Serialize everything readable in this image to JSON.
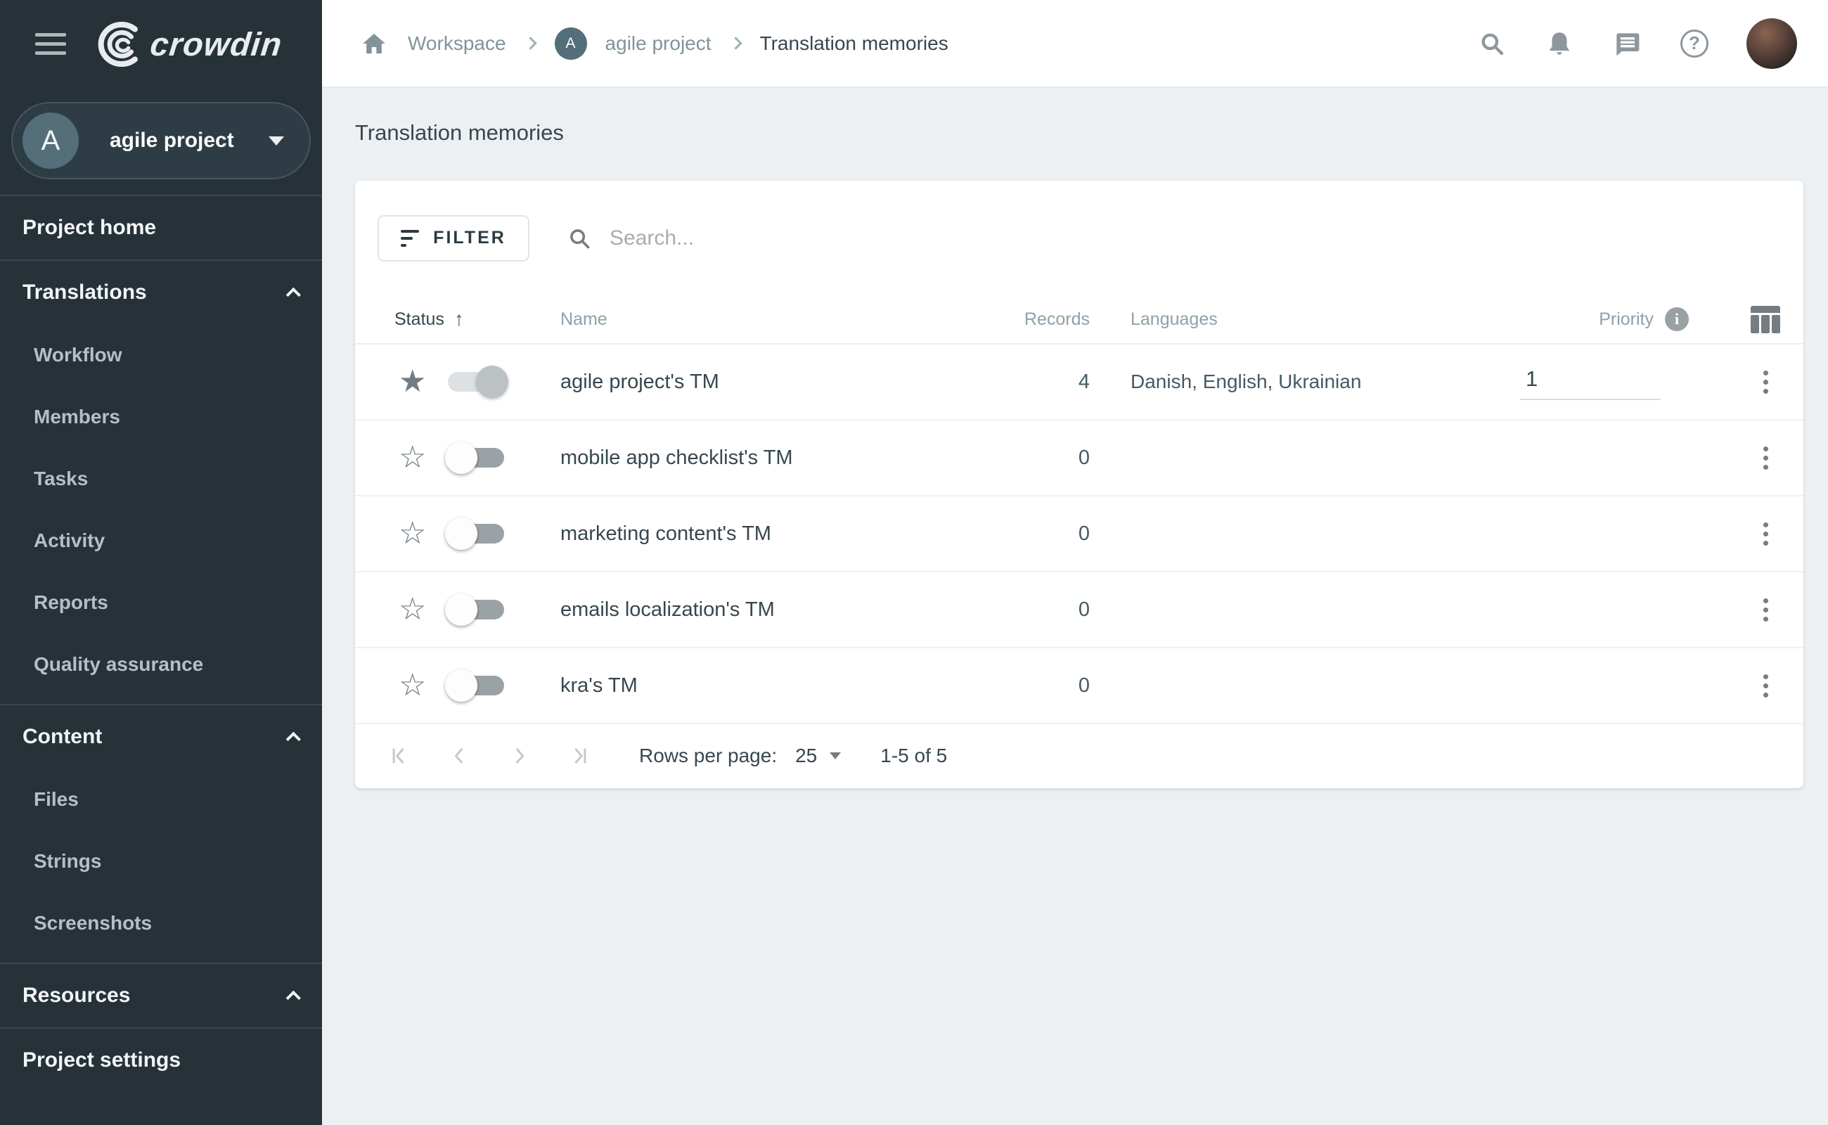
{
  "topbar": {
    "logo_text": "crowdin",
    "breadcrumb": {
      "workspace": "Workspace",
      "project_initial": "A",
      "project": "agile project",
      "page": "Translation memories"
    }
  },
  "sidebar": {
    "project_selector": {
      "initial": "A",
      "name": "agile project"
    },
    "project_home": "Project home",
    "sections": [
      {
        "label": "Translations",
        "items": [
          "Workflow",
          "Members",
          "Tasks",
          "Activity",
          "Reports",
          "Quality assurance"
        ]
      },
      {
        "label": "Content",
        "items": [
          "Files",
          "Strings",
          "Screenshots"
        ]
      },
      {
        "label": "Resources",
        "items": []
      }
    ],
    "project_settings": "Project settings"
  },
  "main": {
    "title": "Translation memories",
    "toolbar": {
      "filter_label": "FILTER",
      "search_placeholder": "Search..."
    },
    "table": {
      "headers": {
        "status": "Status",
        "name": "Name",
        "records": "Records",
        "languages": "Languages",
        "priority": "Priority"
      },
      "rows": [
        {
          "name": "agile project's TM",
          "records": "4",
          "languages": "Danish, English, Ukrainian",
          "priority": "1",
          "starred": true,
          "enabled": true
        },
        {
          "name": "mobile app checklist's TM",
          "records": "0",
          "languages": "",
          "priority": null,
          "starred": false,
          "enabled": false
        },
        {
          "name": "marketing content's TM",
          "records": "0",
          "languages": "",
          "priority": null,
          "starred": false,
          "enabled": false
        },
        {
          "name": "emails localization's TM",
          "records": "0",
          "languages": "",
          "priority": null,
          "starred": false,
          "enabled": false
        },
        {
          "name": "kra's TM",
          "records": "0",
          "languages": "",
          "priority": null,
          "starred": false,
          "enabled": false
        }
      ]
    },
    "pagination": {
      "rows_per_page_label": "Rows per page:",
      "rows_per_page_value": "25",
      "range": "1-5 of 5"
    }
  },
  "icons": {
    "star_filled": "★",
    "star_outline": "☆"
  },
  "colors": {
    "sidebar_bg": "#263238",
    "avatar_teal": "#546E7A",
    "page_bg": "#EDF0F2",
    "text_dark": "#37474F",
    "text_gray": "#90A0A9"
  }
}
